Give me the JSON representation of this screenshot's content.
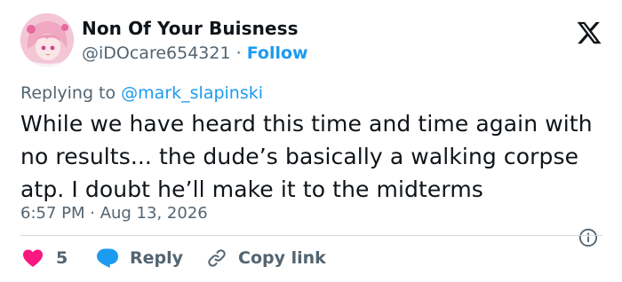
{
  "author": {
    "name": "Non Of Your Buisness",
    "handle": "@iDOcare654321",
    "separator": "·",
    "follow_label": "Follow"
  },
  "platform_icon": "x-logo-icon",
  "replying": {
    "prefix": "Replying to",
    "mention": "@mark_slapinski"
  },
  "tweet": {
    "text": "While we have heard this time and time again with\nno results... the dude’s basically a walking corpse\natp.  I doubt he’ll make it to the midterms"
  },
  "meta": {
    "timestamp": "6:57 PM · Aug 13, 2026"
  },
  "actions": {
    "like_count": "5",
    "reply_label": "Reply",
    "copy_label": "Copy link"
  },
  "colors": {
    "accent": "#1d9bf0",
    "like": "#f91880",
    "muted": "#536471",
    "text": "#0f1419",
    "divider": "#cfd9de"
  }
}
